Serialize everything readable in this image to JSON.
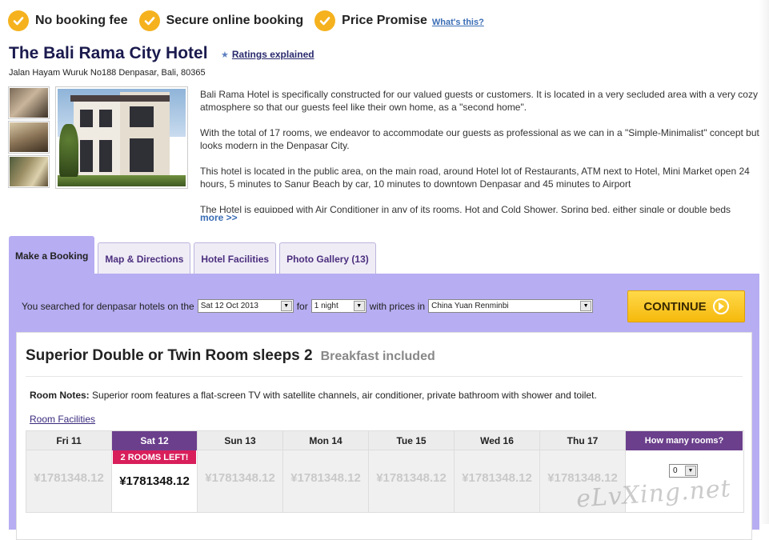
{
  "promises": [
    {
      "label": "No booking fee"
    },
    {
      "label": "Secure online booking"
    },
    {
      "label": "Price Promise"
    }
  ],
  "whats_this": "What's this?",
  "hotel": {
    "name": "The Bali Rama City Hotel",
    "ratings_link": "Ratings explained",
    "address": "Jalan Hayam Wuruk No188 Denpasar, Bali, 80365",
    "description": [
      "Bali Rama Hotel is specifically constructed for our valued guests or customers. It is located in a very secluded area with a very cozy atmosphere so that our guests feel like their own home, as a \"second home\".",
      "With the total of 17 rooms, we endeavor to accommodate our guests as professional as we can in a \"Simple-Minimalist\" concept but looks modern in the Denpasar City.",
      "This hotel is located in the public area, on the main road, around Hotel lot of Restaurants, ATM next to Hotel, Mini Market open 24 hours, 5 minutes to Sanur Beach by car, 10 minutes to downtown Denpasar and 45 minutes to Airport",
      "The Hotel is equipped with Air Conditioner in any of its rooms, Hot and Cold Shower, Spring bed, either single or double beds"
    ],
    "more": "more >>"
  },
  "tabs": [
    {
      "label": "Make a Booking",
      "active": true
    },
    {
      "label": "Map & Directions",
      "active": false
    },
    {
      "label": "Hotel Facilities",
      "active": false
    },
    {
      "label": "Photo Gallery (13)",
      "active": false
    }
  ],
  "search": {
    "prefix": "You searched for denpasar hotels on the",
    "date": "Sat 12 Oct 2013",
    "for": "for",
    "nights": "1 night",
    "prices_in": "with prices in",
    "currency": "China Yuan Renminbi"
  },
  "continue_label": "CONTINUE",
  "room": {
    "title": "Superior Double or Twin Room sleeps 2",
    "breakfast": "Breakfast included",
    "notes_label": "Room Notes:",
    "notes": "Superior room features a flat-screen TV with satellite channels, air conditioner, private bathroom with shower and toilet.",
    "facilities_link": "Room Facilities",
    "days": [
      {
        "day": "Fri 11",
        "price": "¥1781348.12",
        "selected": false
      },
      {
        "day": "Sat 12",
        "price": "¥1781348.12",
        "selected": true,
        "badge": "2 ROOMS LEFT!"
      },
      {
        "day": "Sun 13",
        "price": "¥1781348.12",
        "selected": false
      },
      {
        "day": "Mon 14",
        "price": "¥1781348.12",
        "selected": false
      },
      {
        "day": "Tue 15",
        "price": "¥1781348.12",
        "selected": false
      },
      {
        "day": "Wed 16",
        "price": "¥1781348.12",
        "selected": false
      },
      {
        "day": "Thu 17",
        "price": "¥1781348.12",
        "selected": false
      }
    ],
    "how_many_label": "How many rooms?",
    "qty": "0"
  },
  "watermark": "eLvXing.net",
  "colors": {
    "accent_yellow": "#f5b21e",
    "panel_lavender": "#b6adf2",
    "selected_purple": "#6b3f8c",
    "badge_pink": "#d81e5b"
  }
}
